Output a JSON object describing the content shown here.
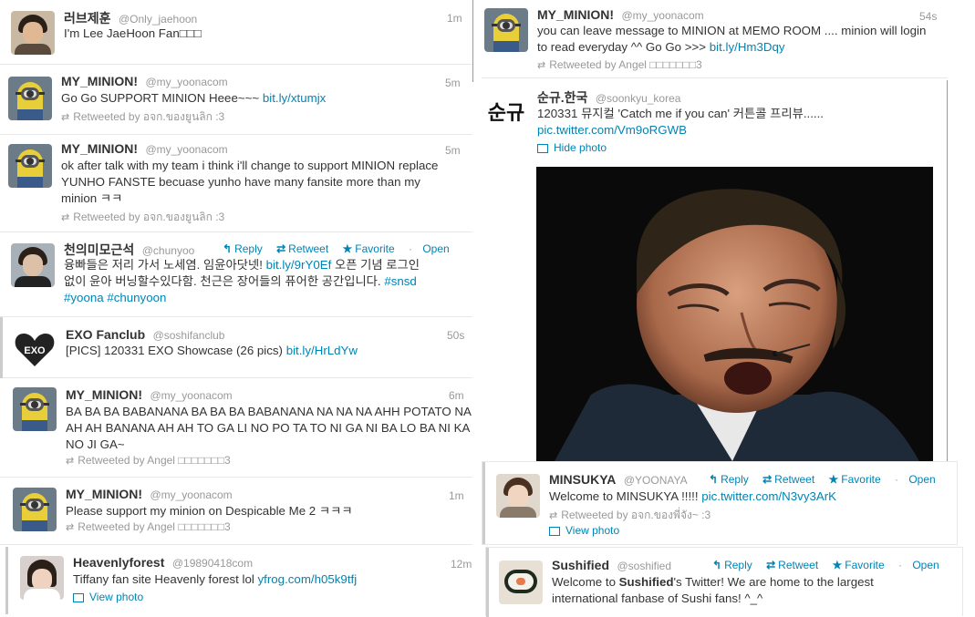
{
  "left": {
    "tweets": [
      {
        "name": "러브제훈",
        "handle": "@Only_jaehoon",
        "time": "1m",
        "text": "I'm Lee JaeHoon Fan□□□"
      },
      {
        "name": "MY_MINION!",
        "handle": "@my_yoonacom",
        "time": "5m",
        "text": "Go Go SUPPORT MINION Heee~~~ ",
        "link": "bit.ly/xtumjx",
        "rt": "Retweeted by อจก.ของยูนลิก :3"
      },
      {
        "name": "MY_MINION!",
        "handle": "@my_yoonacom",
        "time": "5m",
        "lines": [
          "ok after talk with my team i think i'll change to support MINION replace",
          "YUNHO FANSTE becuase yunho have many fansite more than my",
          "minion ㅋㅋ"
        ],
        "rt": "Retweeted by อจก.ของยูนลิก :3"
      },
      {
        "name": "천의미모근석",
        "handle": "@chunyoo",
        "line1a": "융빠들은 저리 가서 노세염. 임윤아닷넷! ",
        "line1b": "bit.ly/9rY0Ef",
        "line1c": " 오픈 기념 로그인",
        "line2a": "없이 윤아 버닝할수있다함. 천근은 장어들의 퓨어한 공간입니다. ",
        "line2b": "#snsd",
        "line3a": "#yoona",
        "line3b": "#chunyoon",
        "reply": "Reply",
        "retweet": "Retweet",
        "favorite": "Favorite",
        "open": "Open"
      },
      {
        "name": "EXO Fanclub",
        "handle": "@soshifanclub",
        "time": "50s",
        "text": "[PICS] 120331 EXO Showcase (26 pics) ",
        "link": "bit.ly/HrLdYw",
        "logo": "EXO"
      },
      {
        "name": "MY_MINION!",
        "handle": "@my_yoonacom",
        "time": "6m",
        "lines": [
          "BA BA BA BABANANA BA BA BA BABANANA NA NA NA AHH POTATO NA",
          "AH AH BANANA AH AH TO GA LI NO PO TA TO NI GA NI BA LO BA NI KA",
          "NO JI GA~"
        ],
        "rt": "Retweeted by Angel □□□□□□□3"
      },
      {
        "name": "MY_MINION!",
        "handle": "@my_yoonacom",
        "time": "1m",
        "text": "Please support my minion on Despicable Me 2 ㅋㅋㅋ",
        "rt": "Retweeted by Angel □□□□□□□3"
      },
      {
        "name": "Heavenlyforest",
        "handle": "@19890418com",
        "time": "12m",
        "text": "Tiffany fan site Heavenly forest lol ",
        "link": "yfrog.com/h05k9tfj",
        "photo": "View photo"
      }
    ]
  },
  "right": {
    "tweets": [
      {
        "name": "MY_MINION!",
        "handle": "@my_yoonacom",
        "time": "54s",
        "line1": "you can leave message to MINION at MEMO ROOM .... minion will login",
        "line2a": "to read everyday ^^ Go Go >>> ",
        "line2b": "bit.ly/Hm3Dqy",
        "rt": "Retweeted by Angel □□□□□□□3"
      },
      {
        "name": "순규.한국",
        "handle": "@soonkyu_korea",
        "logo": "순규",
        "line1": "120331 뮤지컬 'Catch me if you can' 커튼콜 프리뷰......",
        "line2": "pic.twitter.com/Vm9oRGWB",
        "photo": "Hide photo"
      },
      {
        "name": "MINSUKYA",
        "handle": "@YOONAYA",
        "text": "Welcome to MINSUKYA !!!!! ",
        "link": "pic.twitter.com/N3vy3ArK",
        "rt": "Retweeted by อจก.ของพี่จัง~ :3",
        "photo": "View photo",
        "reply": "Reply",
        "retweet": "Retweet",
        "favorite": "Favorite",
        "open": "Open"
      },
      {
        "name": "Sushified",
        "handle": "@soshified",
        "line1a": "Welcome to ",
        "line1b": "Sushified",
        "line1c": "'s Twitter! We are home to the largest",
        "line2": "international fanbase of Sushi fans! ^_^",
        "reply": "Reply",
        "retweet": "Retweet",
        "favorite": "Favorite",
        "open": "Open"
      }
    ]
  },
  "colors": {
    "link": "#0084b4",
    "meta": "#999999",
    "text": "#333333"
  }
}
